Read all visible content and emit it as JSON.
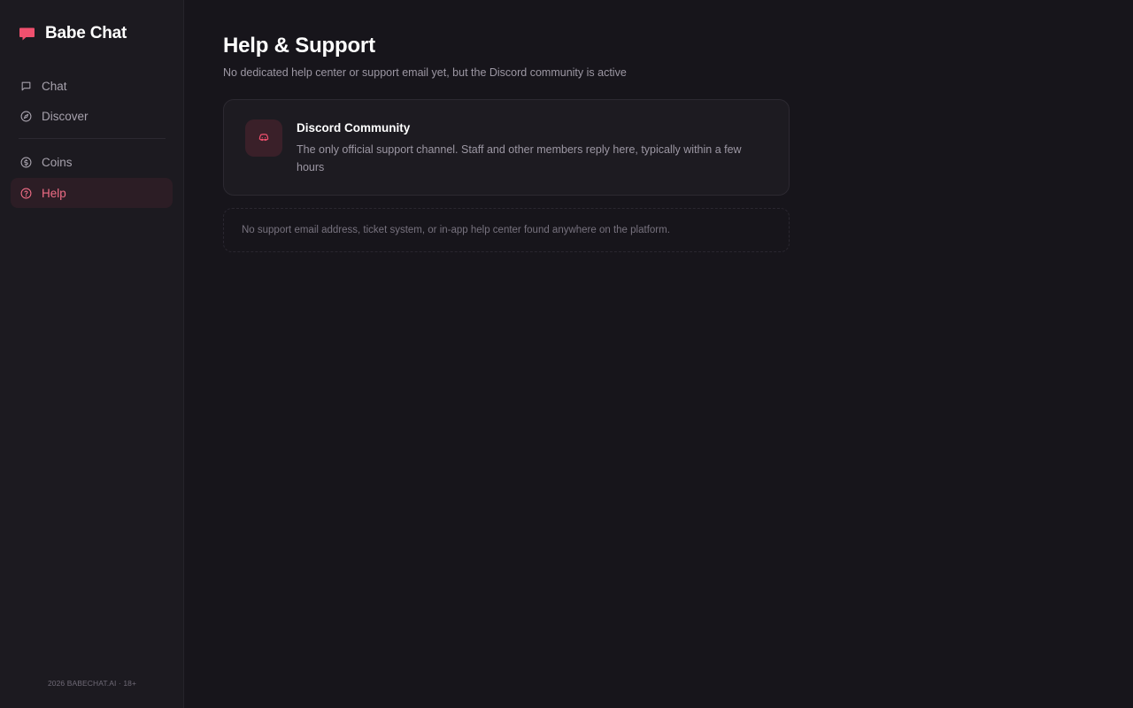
{
  "brand": {
    "name": "Babe Chat",
    "icon": "chat-bubble-icon",
    "accent_color": "#f0506e"
  },
  "sidebar": {
    "items": [
      {
        "label": "Chat",
        "icon": "message-square-icon",
        "active": false
      },
      {
        "label": "Discover",
        "icon": "compass-icon",
        "active": false
      },
      {
        "label": "Coins",
        "icon": "coin-icon",
        "active": false
      },
      {
        "label": "Help",
        "icon": "help-circle-icon",
        "active": true
      }
    ],
    "footer": "2026 BABECHAT.AI · 18+"
  },
  "main": {
    "title": "Help & Support",
    "subtitle": "No dedicated help center or support email yet, but the Discord community is active",
    "card": {
      "icon": "discord-icon",
      "title": "Discord Community",
      "description": "The only official support channel. Staff and other members reply here, typically within a few hours"
    },
    "notice": "No support email address, ticket system, or in-app help center found anywhere on the platform."
  },
  "colors": {
    "background": "#17151b",
    "sidebar": "#1c1a20",
    "card": "#1d1b21",
    "active_bg": "#2c1d25",
    "active_text": "#f06d86"
  }
}
